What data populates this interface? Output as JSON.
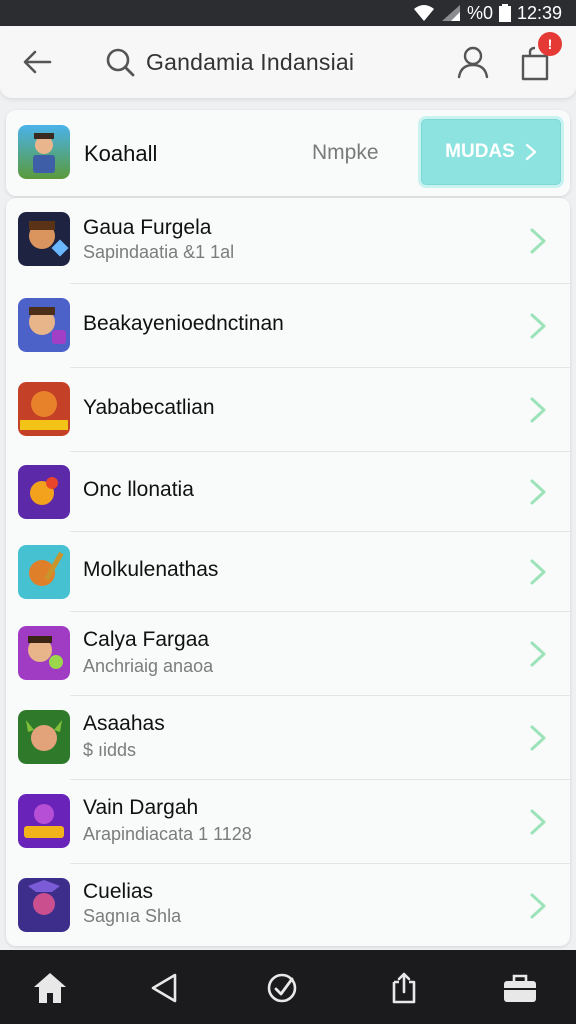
{
  "status_bar": {
    "battery_text": "%0",
    "time": "12:39"
  },
  "header": {
    "title": "Gandamia Indansiai",
    "cart_badge": "!"
  },
  "featured": {
    "name": "Koahall",
    "meta": "Nmpke",
    "button_label": "MUDAS"
  },
  "items": [
    {
      "title": "Gaua Furgela",
      "subtitle": "Sapindaatia &1 1al"
    },
    {
      "title": "Beakayenioednctinan",
      "subtitle": ""
    },
    {
      "title": "Yababecatlian",
      "subtitle": ""
    },
    {
      "title": "Onc llonatia",
      "subtitle": ""
    },
    {
      "title": "Molkulenathas",
      "subtitle": ""
    },
    {
      "title": "Calya Fargaa",
      "subtitle": "Anchriaig anaoa"
    },
    {
      "title": "Asaahas",
      "subtitle": "$ ıidds"
    },
    {
      "title": "Vain Dargah",
      "subtitle": "Arapindiacata 1 1128"
    },
    {
      "title": "Cuelias",
      "subtitle": "Sagnıa Shla"
    }
  ],
  "icons": {
    "back": "arrow-left-icon",
    "search": "search-icon",
    "user": "user-icon",
    "cart": "shopping-bag-icon",
    "chevron": "chevron-right-icon",
    "nav": [
      "home-icon",
      "back-triangle-icon",
      "check-circle-icon",
      "share-icon",
      "briefcase-icon"
    ]
  },
  "colors": {
    "accent": "#8ce3e0",
    "chevron": "#9de3b9",
    "badge": "#e53935",
    "status_bar": "#2b2d31",
    "nav_bar": "#1b1b1d"
  }
}
